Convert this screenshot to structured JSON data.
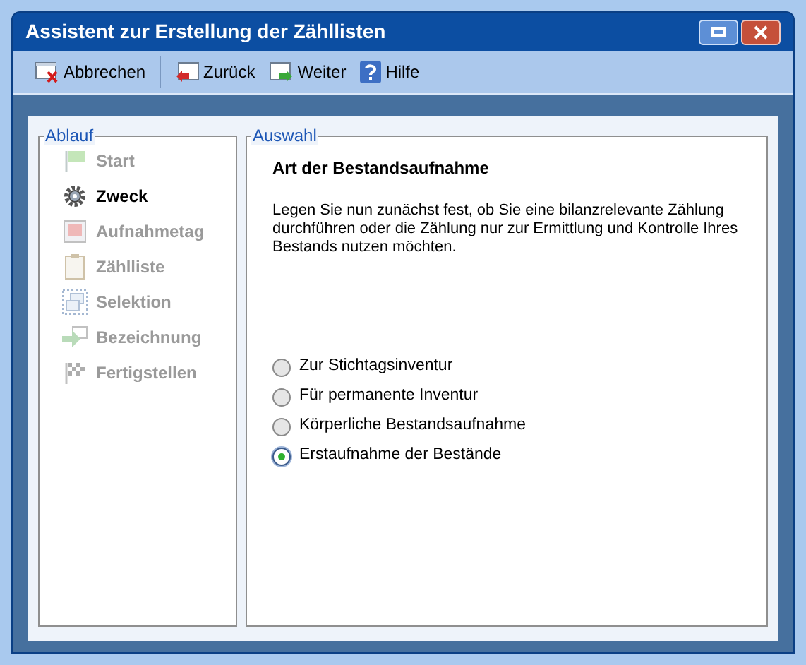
{
  "window": {
    "title": "Assistent zur Erstellung der Zähllisten"
  },
  "toolbar": [
    {
      "kind": "cancel",
      "label": "Abbrechen"
    },
    {
      "kind": "back",
      "label": "Zurück"
    },
    {
      "kind": "next",
      "label": "Weiter"
    },
    {
      "kind": "help",
      "label": "Hilfe"
    }
  ],
  "ablauf": {
    "title": "Ablauf",
    "steps": [
      {
        "kind": "flag",
        "label": "Start",
        "selected": false
      },
      {
        "kind": "gear",
        "label": "Zweck",
        "selected": true
      },
      {
        "kind": "calendar",
        "label": "Aufnahmetag",
        "selected": false
      },
      {
        "kind": "clipboard",
        "label": "Zählliste",
        "selected": false
      },
      {
        "kind": "selection",
        "label": "Selektion",
        "selected": false
      },
      {
        "kind": "rename",
        "label": "Bezeichnung",
        "selected": false
      },
      {
        "kind": "finish",
        "label": "Fertigstellen",
        "selected": false
      }
    ]
  },
  "auswahl": {
    "title": "Auswahl",
    "heading": "Art der Bestandsaufnahme",
    "description": "Legen Sie nun zunächst fest, ob Sie eine bilanzrelevante Zählung durchführen oder die Zählung nur zur Ermittlung und Kontrolle Ihres Bestands nutzen möchten.",
    "options": [
      {
        "label": "Zur Stichtagsinventur",
        "selected": false
      },
      {
        "label": "Für permanente Inventur",
        "selected": false
      },
      {
        "label": "Körperliche Bestandsaufnahme",
        "selected": false
      },
      {
        "label": "Erstaufnahme der Bestände",
        "selected": true
      }
    ]
  }
}
